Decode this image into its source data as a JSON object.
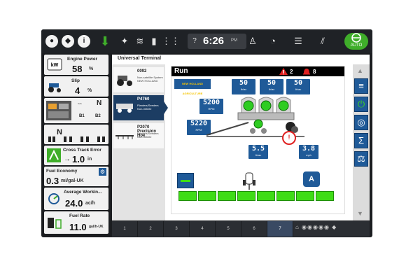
{
  "topbar": {
    "clock": "6:26",
    "ampm": "PM"
  },
  "left": {
    "engine_power": {
      "label": "Engine Power",
      "value": "58",
      "unit": "%"
    },
    "slip": {
      "label": "Slip",
      "value": "4",
      "unit": "%"
    },
    "hitch": {
      "rear_label": "N",
      "b1": "B1",
      "b2": "B2",
      "front_label": "N"
    },
    "cross_track": {
      "label": "Cross Track Error",
      "value": "1.0",
      "unit": "in"
    },
    "fuel_economy": {
      "label": "Fuel Economy",
      "value": "0.3",
      "unit": "mi/gal-UK"
    },
    "avg_work": {
      "label": "Average Workin...",
      "value": "24.0",
      "unit": "ac/h"
    },
    "fuel_rate": {
      "label": "Fuel Rate",
      "value": "11.0",
      "unit": "gal/h-UK"
    }
  },
  "ut": {
    "title": "Universal Terminal",
    "implements": [
      {
        "code": "0092",
        "sub": "Non-satellite System NEW HOLLAND"
      },
      {
        "code": "P4760",
        "sub": "Planters/Seeders Non-Infinite"
      },
      {
        "code": "P2070 Precision Hoe",
        "sub": "Planters/Seeders Non-Infinite"
      }
    ],
    "run_label": "Run",
    "alarm_count_1": "2",
    "alarm_count_2": "8",
    "brand": "NEW HOLLAND AGRICULTURE",
    "rates_top": [
      {
        "value": "50",
        "unit": "lb/ac"
      },
      {
        "value": "50",
        "unit": "lb/ac"
      },
      {
        "value": "50",
        "unit": "lb/ac"
      }
    ],
    "rpm_1": {
      "value": "5200",
      "unit": "RPM"
    },
    "rpm_2": {
      "value": "5220",
      "unit": "RPM"
    },
    "rate_mid": {
      "value": "5.5",
      "unit": "lb/ac"
    },
    "speed": {
      "value": "3.8",
      "unit": "mph"
    },
    "sections_count": 8
  },
  "tabs": [
    "1",
    "2",
    "3",
    "4",
    "5",
    "6",
    "7"
  ],
  "colors": {
    "panel_blue": "#1f5a98",
    "section_green": "#3fdc16",
    "auto_green": "#3fae2a",
    "alarm_red": "#e02020"
  }
}
